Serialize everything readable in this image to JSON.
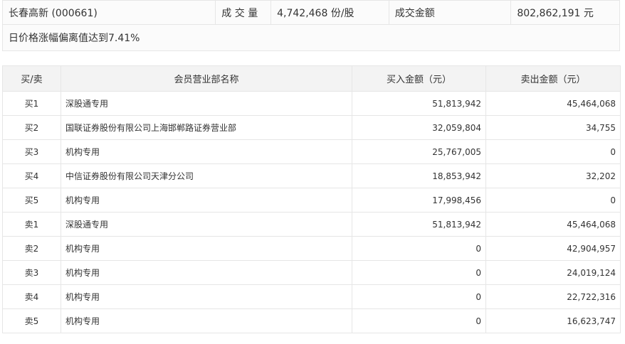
{
  "summary": {
    "stock": "长春高新 (000661)",
    "volume_label": "成 交 量",
    "volume_value": "4,742,468 份/股",
    "amount_label": "成交金额",
    "amount_value": "802,862,191 元",
    "reason": "日价格涨幅偏离值达到7.41%"
  },
  "table": {
    "headers": {
      "side": "买/卖",
      "name": "会员营业部名称",
      "buy": "买入金额（元）",
      "sell": "卖出金额（元）"
    },
    "rows": [
      {
        "side": "买1",
        "name": "深股通专用",
        "buy": "51,813,942",
        "sell": "45,464,068"
      },
      {
        "side": "买2",
        "name": "国联证券股份有限公司上海邯郸路证券营业部",
        "buy": "32,059,804",
        "sell": "34,755"
      },
      {
        "side": "买3",
        "name": "机构专用",
        "buy": "25,767,005",
        "sell": "0"
      },
      {
        "side": "买4",
        "name": "中信证券股份有限公司天津分公司",
        "buy": "18,853,942",
        "sell": "32,202"
      },
      {
        "side": "买5",
        "name": "机构专用",
        "buy": "17,998,456",
        "sell": "0"
      },
      {
        "side": "卖1",
        "name": "深股通专用",
        "buy": "51,813,942",
        "sell": "45,464,068"
      },
      {
        "side": "卖2",
        "name": "机构专用",
        "buy": "0",
        "sell": "42,904,957"
      },
      {
        "side": "卖3",
        "name": "机构专用",
        "buy": "0",
        "sell": "24,019,124"
      },
      {
        "side": "卖4",
        "name": "机构专用",
        "buy": "0",
        "sell": "22,722,316"
      },
      {
        "side": "卖5",
        "name": "机构专用",
        "buy": "0",
        "sell": "16,623,747"
      }
    ]
  }
}
